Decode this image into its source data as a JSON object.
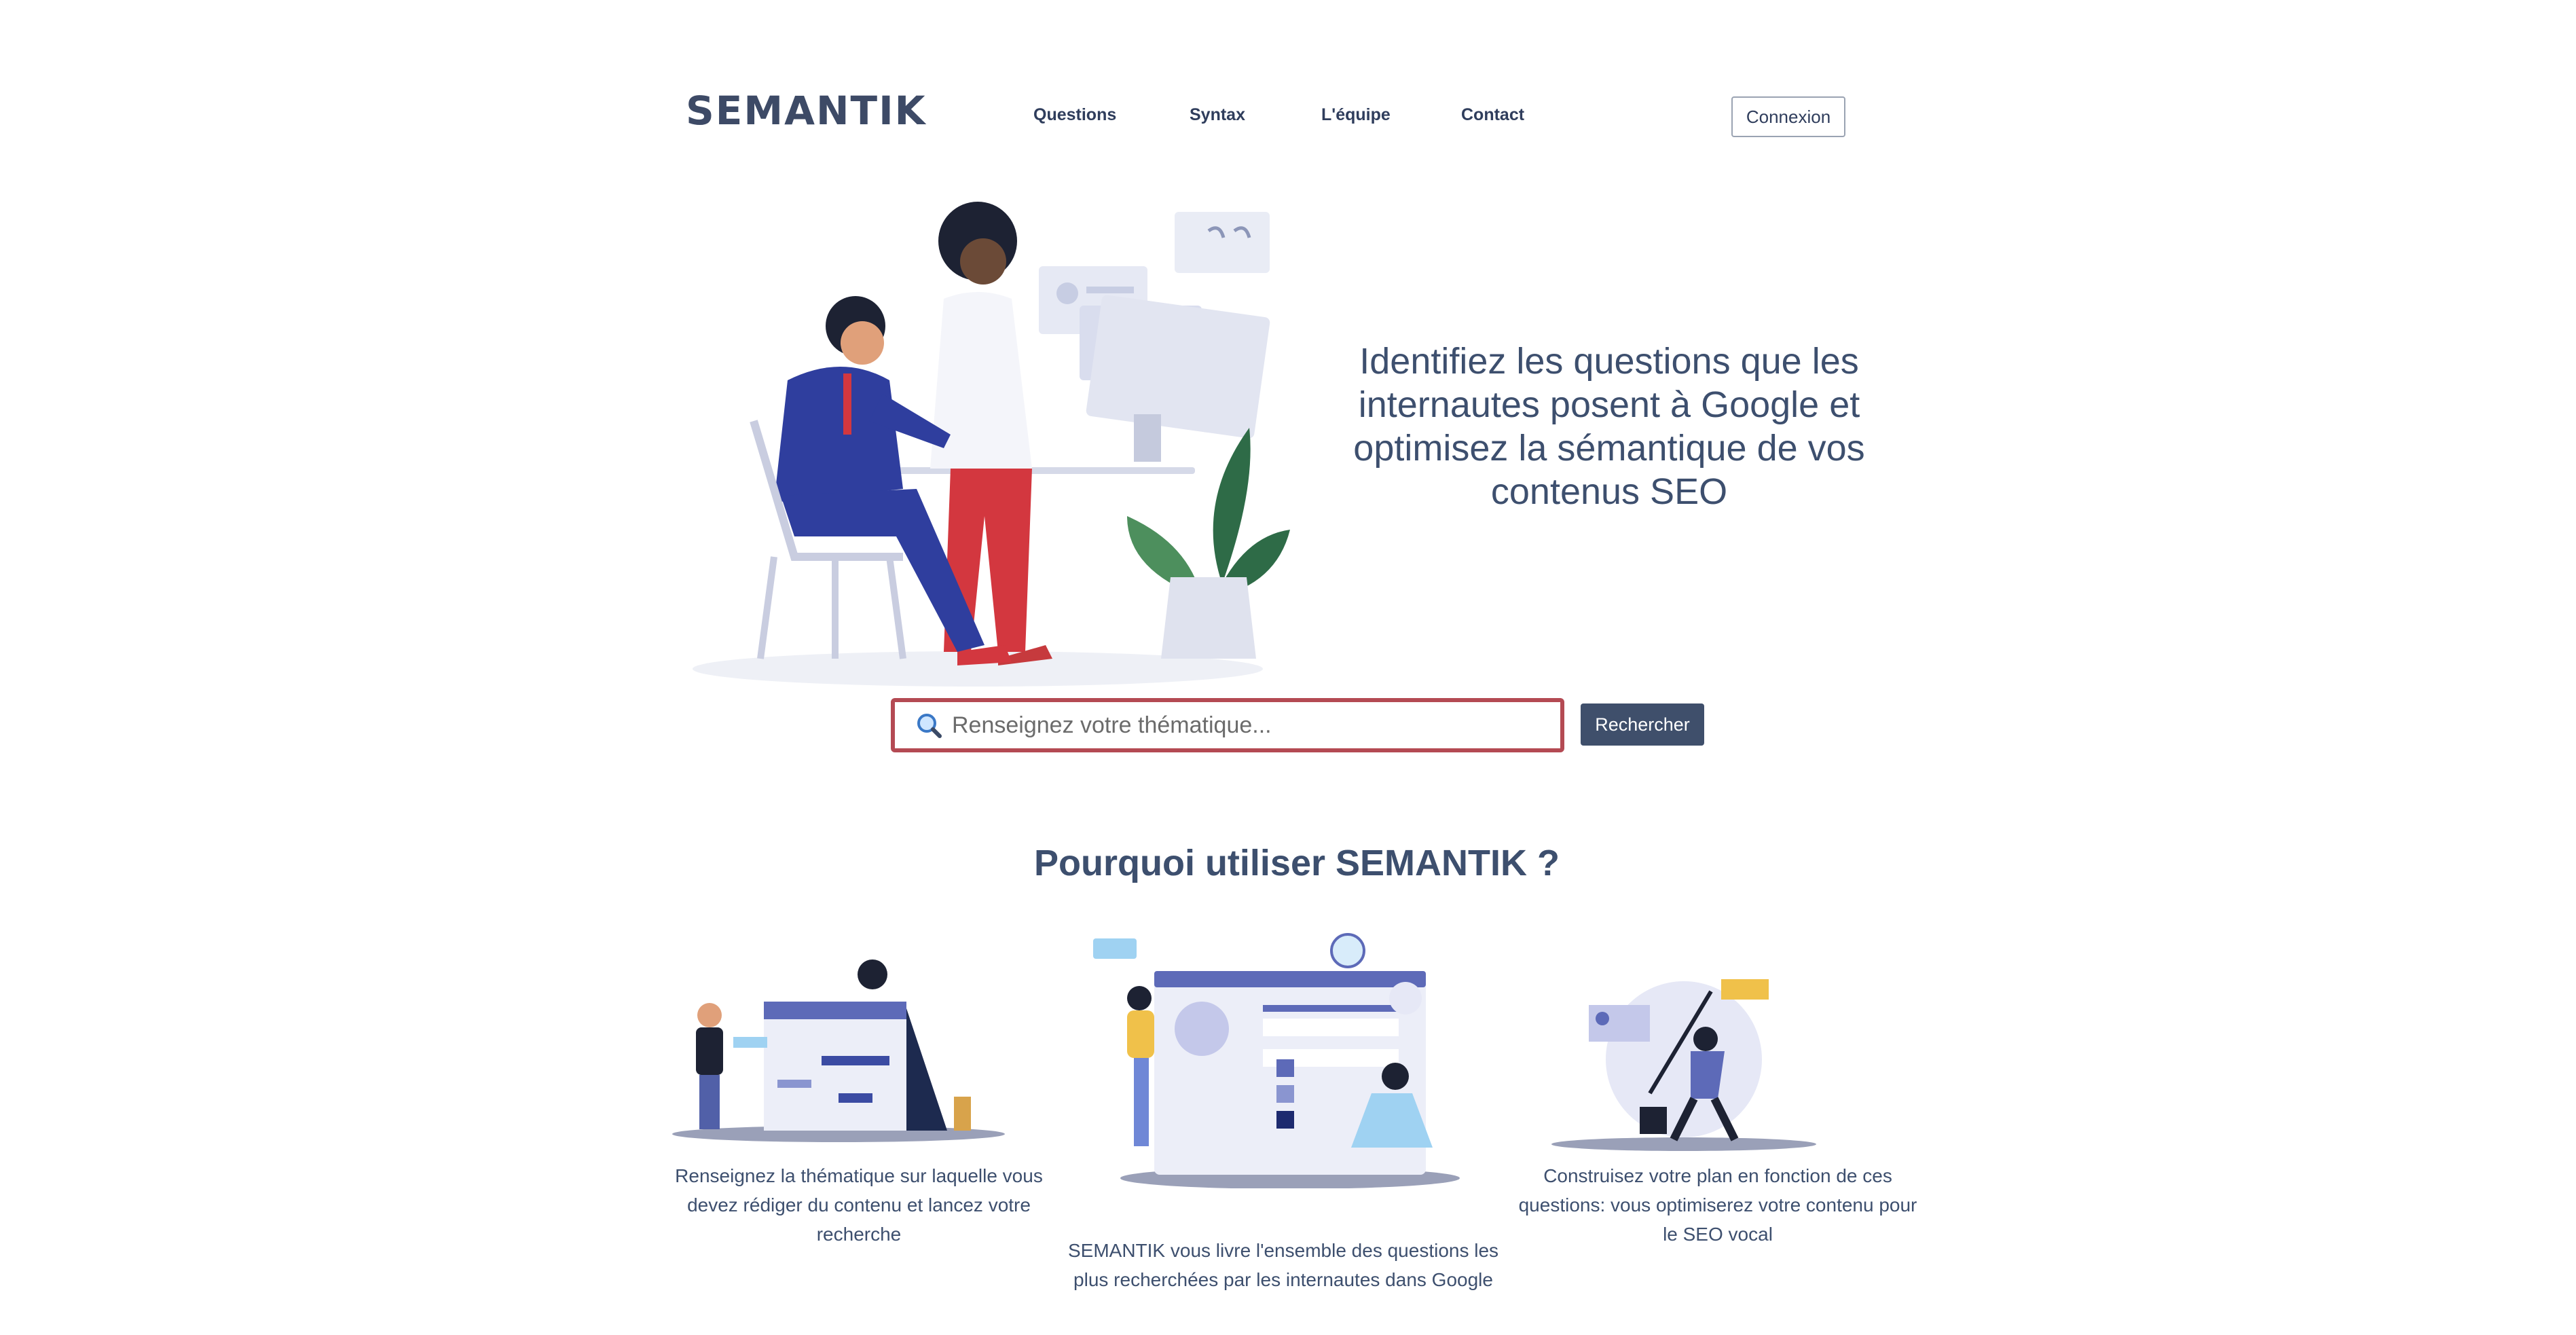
{
  "header": {
    "logo": "SEMANTIK",
    "nav": [
      "Questions",
      "Syntax",
      "L'équipe",
      "Contact"
    ],
    "login_label": "Connexion"
  },
  "hero": {
    "headline": [
      "Identifiez les questions que les",
      "internautes posent à Google et",
      "optimisez la sémantique de vos",
      "contenus SEO"
    ]
  },
  "search": {
    "placeholder": "Renseignez votre thématique...",
    "value": "",
    "button_label": "Rechercher",
    "icon": "search-icon"
  },
  "why": {
    "title": "Pourquoi utiliser SEMANTIK ?",
    "features": [
      {
        "lines": [
          "Renseignez la thématique sur laquelle vous",
          "devez rédiger du contenu et lancez votre",
          "recherche"
        ]
      },
      {
        "lines": [
          "SEMANTIK vous livre l'ensemble des questions les",
          "plus recherchées par les internautes dans Google"
        ]
      },
      {
        "lines": [
          "Construisez votre plan en fonction de ces",
          "questions: vous optimiserez votre contenu pour",
          "le SEO vocal"
        ]
      }
    ]
  },
  "colors": {
    "primary": "#3d4f6e",
    "accent_red": "#b44a53",
    "button": "#3f4f6b"
  }
}
